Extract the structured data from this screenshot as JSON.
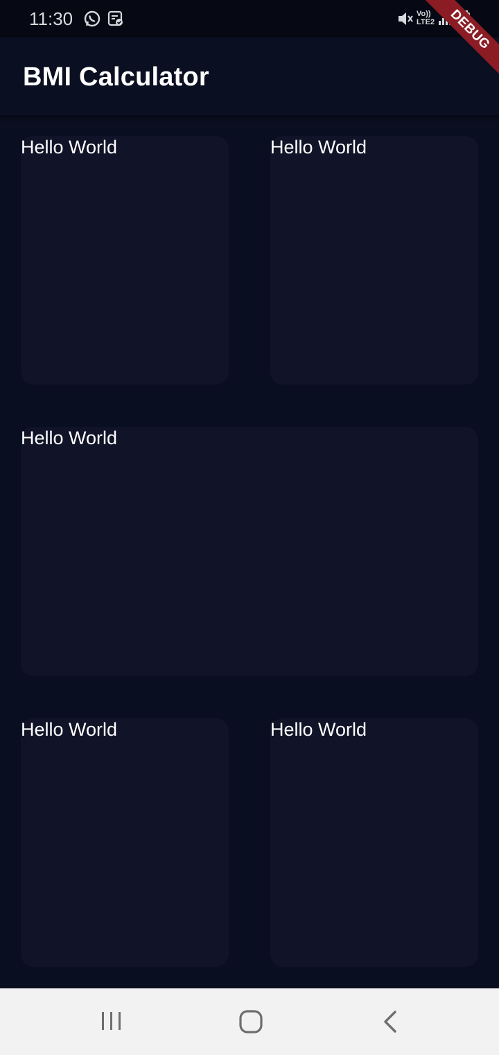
{
  "status_bar": {
    "time": "11:30",
    "icons": [
      "whatsapp-icon",
      "assistant-icon",
      "mute-icon",
      "volte-icon",
      "signal-icon",
      "battery-icon"
    ],
    "volte_line1": "Vo))",
    "volte_line2": "LTE2"
  },
  "app_bar": {
    "title": "BMI Calculator"
  },
  "cards": [
    {
      "label": "Hello World"
    },
    {
      "label": "Hello World"
    },
    {
      "label": "Hello World"
    },
    {
      "label": "Hello World"
    },
    {
      "label": "Hello World"
    }
  ],
  "debug_banner": {
    "label": "DEBUG"
  },
  "nav_bar": {
    "icons": [
      "recent-apps-icon",
      "home-icon",
      "back-icon"
    ]
  },
  "colors": {
    "background": "#0a0e21",
    "card": "#111328",
    "debug_ribbon": "#8b1c24"
  }
}
